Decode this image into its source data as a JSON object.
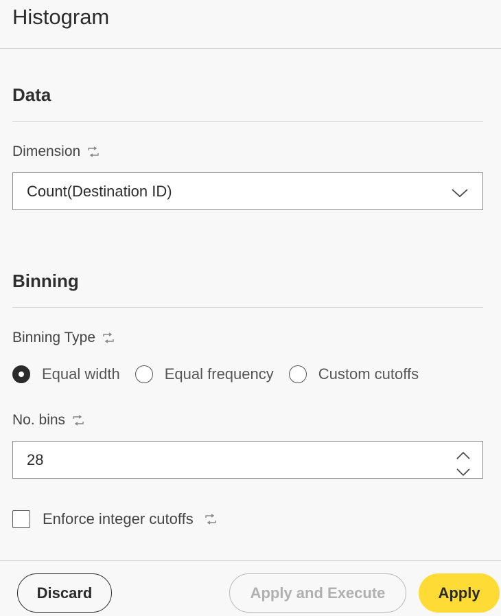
{
  "header": {
    "title": "Histogram"
  },
  "data_section": {
    "title": "Data",
    "dimension_label": "Dimension",
    "dimension_value": "Count(Destination ID)"
  },
  "binning_section": {
    "title": "Binning",
    "binning_type_label": "Binning Type",
    "binning_options": [
      {
        "label": "Equal width",
        "selected": true
      },
      {
        "label": "Equal frequency",
        "selected": false
      },
      {
        "label": "Custom cutoffs",
        "selected": false
      }
    ],
    "bins_label": "No. bins",
    "bins_value": "28",
    "enforce_integer_label": "Enforce integer cutoffs",
    "enforce_integer_checked": false
  },
  "footer": {
    "discard_label": "Discard",
    "apply_execute_label": "Apply and Execute",
    "apply_label": "Apply"
  },
  "colors": {
    "accent": "#fedb35",
    "background": "#f8f8f8",
    "text": "#2b2b2b",
    "disabled": "#b0b0b0"
  },
  "icons": {
    "link": "link-icon",
    "chevron": "chevron-down-icon",
    "stepper_up": "chevron-up-icon",
    "stepper_down": "chevron-down-icon"
  }
}
